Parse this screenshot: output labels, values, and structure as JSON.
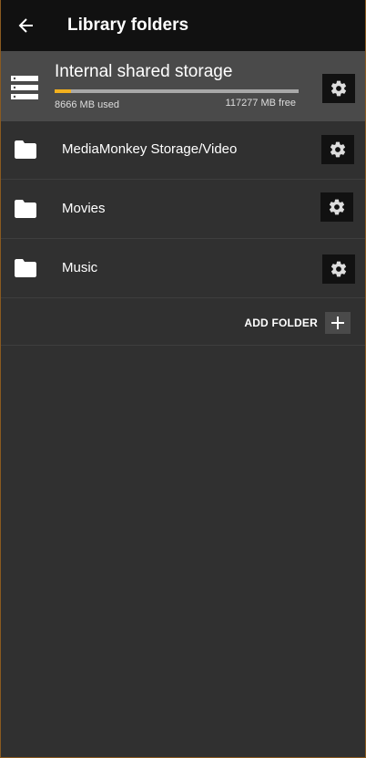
{
  "appbar": {
    "title": "Library folders",
    "back_icon": "arrow-left-icon"
  },
  "storage": {
    "title": "Internal shared storage",
    "used": "8666 MB used",
    "free": "117277 MB free",
    "used_fraction": 0.069,
    "accent": "#f2b01e"
  },
  "folders": [
    {
      "label": "MediaMonkey Storage/Video"
    },
    {
      "label": "Movies"
    },
    {
      "label": "Music"
    }
  ],
  "add_folder": {
    "label": "ADD FOLDER"
  },
  "colors": {
    "background": "#303030",
    "appbar": "#111111",
    "storage_row": "#4a4a4a"
  }
}
